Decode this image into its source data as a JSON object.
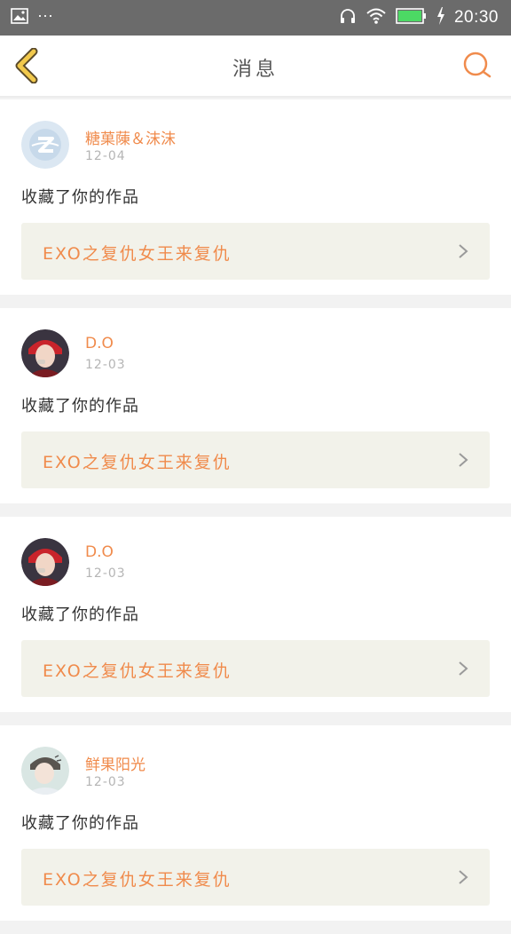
{
  "status_bar": {
    "left_icons": [
      "image-icon",
      "more-dots-icon"
    ],
    "dots": "···",
    "right_icons": [
      "headphones-icon",
      "wifi-icon",
      "battery-icon",
      "charging-icon"
    ],
    "time": "20:30",
    "colors": {
      "bg": "#6b6b6b",
      "battery": "#4cd964"
    }
  },
  "header": {
    "title": "消息",
    "back_icon": "chevron-left-icon",
    "search_icon": "search-icon",
    "colors": {
      "back": "#f2c94c",
      "search": "#f08b4c"
    }
  },
  "notifications": [
    {
      "user": "糖菓蔯＆沫沫",
      "date": "12-04",
      "action": "收藏了你的作品",
      "work_title": "EXO之复仇女王来复仇",
      "avatar": "qq-default-avatar"
    },
    {
      "user": "D.O",
      "date": "12-03",
      "action": "收藏了你的作品",
      "work_title": "EXO之复仇女王来复仇",
      "avatar": "user-photo-avatar"
    },
    {
      "user": "D.O",
      "date": "12-03",
      "action": "收藏了你的作品",
      "work_title": "EXO之复仇女王来复仇",
      "avatar": "user-photo-avatar"
    },
    {
      "user": "鲜果阳光",
      "date": "12-03",
      "action": "收藏了你的作品",
      "work_title": "EXO之复仇女王来复仇",
      "avatar": "user-photo-avatar"
    }
  ],
  "colors": {
    "accent": "#f08b4c",
    "card_link_bg": "#f2f2ea"
  }
}
